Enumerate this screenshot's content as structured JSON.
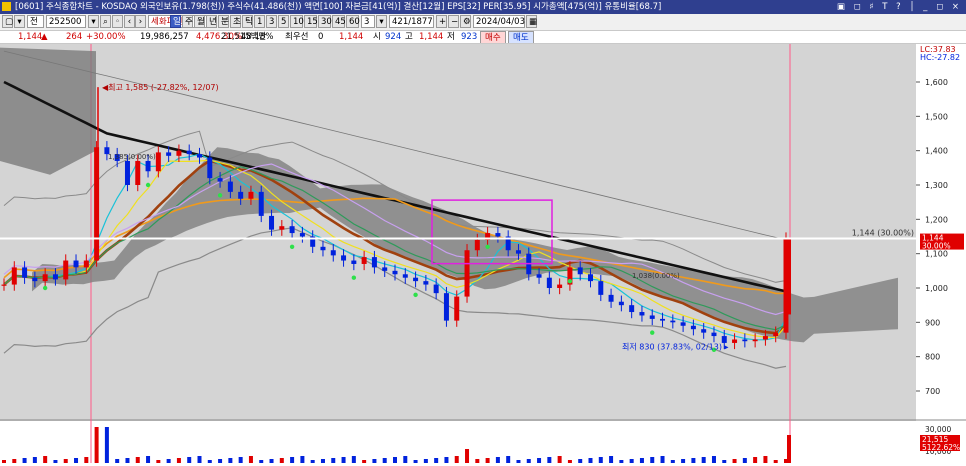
{
  "window": {
    "title": "[0601] 주식종합차트 - KOSDAQ 외국인보유(1.798(천)) 주식수(41.486(천)) 액면[100] 자본금[41(억)] 결산[12월] EPS[32] PER[35.95] 시가총액[475(억)] 유통비율[68.7]",
    "controls": "▣ ◻ ♯ T ? │ _ ◻ ×"
  },
  "toolbar": {
    "mode": "전",
    "code": "252500",
    "name": "세화피앤씨",
    "periods": [
      "일",
      "주",
      "월",
      "년",
      "분",
      "초",
      "틱"
    ],
    "active_period": "일",
    "minutes": [
      "1",
      "3",
      "5",
      "10",
      "15",
      "30",
      "45",
      "60"
    ],
    "interval": "3",
    "range": "421/1877",
    "date": "2024/04/03"
  },
  "quote": {
    "price": "1,144",
    "arrow": "▲",
    "change": "264",
    "change_pct": "+30.00%",
    "volume": "19,986,257",
    "volume_pct": "4,476.30%",
    "turnover": "48.18%",
    "amount": "21,515백만",
    "pref_label": "최우선",
    "pref_value": "0",
    "open_price": "1,144",
    "open_label": "시",
    "open_value": "924",
    "high_label": "고",
    "high_value": "1,144",
    "low_label": "저",
    "low_value": "923",
    "buy_button": "매수",
    "sell_button": "매도"
  },
  "chart_data": {
    "type": "candlestick",
    "y_axis_ticks": [
      1600,
      1500,
      1400,
      1300,
      1200,
      1100,
      1000,
      900,
      800,
      700
    ],
    "y_tick_labels": [
      "1,600",
      "1,500",
      "1,400",
      "1,300",
      "1,200",
      "1,100",
      "1,000",
      "900",
      "800",
      "700"
    ],
    "ylim": [
      620,
      1720
    ],
    "top_labels": [
      "LC:37.83",
      "HC:-27.82"
    ],
    "high_annotation": "최고 1,585 (-27.82%, 12/07)",
    "low_annotation": "최저 830 (37.83%, 02/13)",
    "small_annotations": [
      "1,385(0.00%)",
      "1,038(0.00%)"
    ],
    "current_price_line": {
      "value": 1144,
      "label": "1,144 (30.00%)"
    },
    "price_tags": [
      "1,144",
      "30.00%"
    ],
    "close_series": [
      1010,
      1060,
      1030,
      1020,
      1040,
      1025,
      1080,
      1060,
      1080,
      1410,
      1390,
      1370,
      1300,
      1370,
      1340,
      1395,
      1385,
      1400,
      1390,
      1380,
      1320,
      1310,
      1280,
      1260,
      1280,
      1210,
      1170,
      1180,
      1160,
      1150,
      1120,
      1110,
      1095,
      1080,
      1070,
      1090,
      1060,
      1050,
      1040,
      1030,
      1020,
      1010,
      985,
      905,
      975,
      1110,
      1140,
      1160,
      1150,
      1110,
      1100,
      1040,
      1030,
      1000,
      1010,
      1060,
      1040,
      1020,
      980,
      960,
      950,
      930,
      920,
      910,
      905,
      900,
      890,
      880,
      870,
      860,
      840,
      850,
      845,
      850,
      860,
      870,
      1144
    ],
    "volume_panel": {
      "axis_labels": [
        "30,000",
        "10,000"
      ],
      "tags": [
        "21,515",
        "5122.62%"
      ]
    }
  },
  "colors": {
    "background": "#d4d4d4",
    "cloud": "#7a7a7a",
    "ma_long": "#111111",
    "ma_brown": "#a0410f",
    "ma_orange": "#f09a1c",
    "bollinger": "#8a8a8a",
    "up_candle": "#e00000",
    "down_candle": "#0022dd",
    "highlight_box": "#e020e0",
    "cursor_line": "#ff5a88"
  }
}
